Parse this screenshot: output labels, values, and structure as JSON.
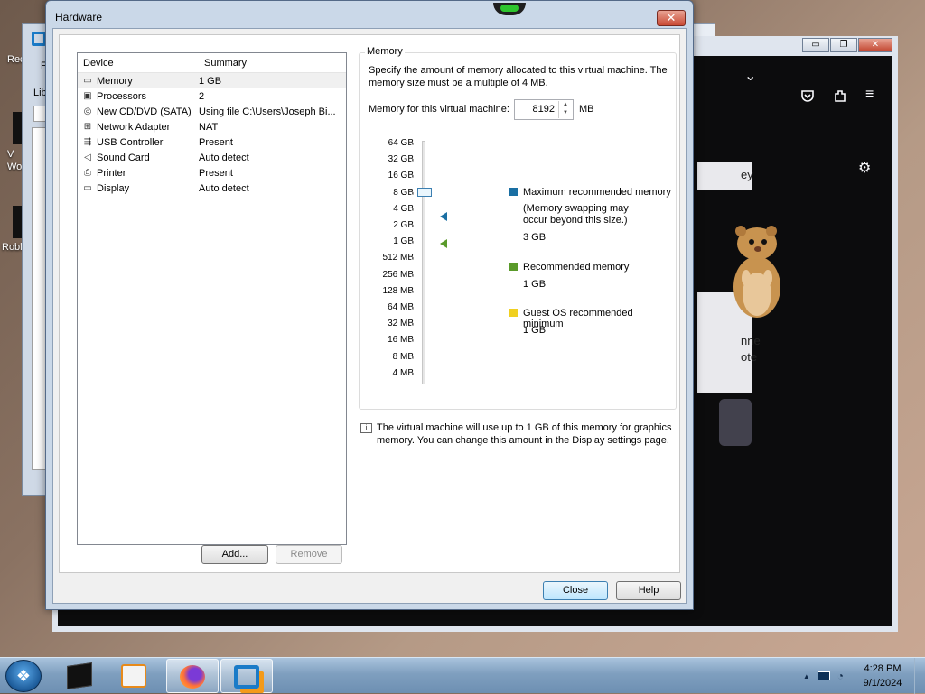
{
  "desktop": {
    "icons": [
      {
        "label": "Rec"
      },
      {
        "label": "V Wo"
      },
      {
        "label": "Robl"
      }
    ]
  },
  "bg_window_left": {
    "frag_1": "F",
    "frag_2": "Lib"
  },
  "firefox": {
    "partial_texts": [
      "ey",
      "nne",
      "ote"
    ],
    "controls": {
      "minimize": "▭",
      "restore": "❐",
      "close": "✕"
    },
    "icons": [
      "chevron-down-icon",
      "pocket-icon",
      "extensions-icon",
      "menu-icon",
      "settings-icon",
      "back-arrow-icon"
    ]
  },
  "dialog": {
    "title": "Hardware",
    "close_glyph": "✕",
    "device_list": {
      "col_device": "Device",
      "col_summary": "Summary",
      "rows": [
        {
          "icon": "memory-icon",
          "device": "Memory",
          "summary": "1 GB"
        },
        {
          "icon": "processor-icon",
          "device": "Processors",
          "summary": "2"
        },
        {
          "icon": "cd-dvd-icon",
          "device": "New CD/DVD (SATA)",
          "summary": "Using file C:\\Users\\Joseph Bi..."
        },
        {
          "icon": "network-adapter-icon",
          "device": "Network Adapter",
          "summary": "NAT"
        },
        {
          "icon": "usb-icon",
          "device": "USB Controller",
          "summary": "Present"
        },
        {
          "icon": "sound-card-icon",
          "device": "Sound Card",
          "summary": "Auto detect"
        },
        {
          "icon": "printer-icon",
          "device": "Printer",
          "summary": "Present"
        },
        {
          "icon": "display-icon",
          "device": "Display",
          "summary": "Auto detect"
        }
      ]
    },
    "add_label": "Add...",
    "remove_label": "Remove",
    "memory": {
      "group_title": "Memory",
      "description": "Specify the amount of memory allocated to this virtual machine. The memory size must be a multiple of 4 MB.",
      "field_label": "Memory for this virtual machine:",
      "field_value": "8192",
      "unit": "MB",
      "scale": [
        "64 GB",
        "32 GB",
        "16 GB",
        "8 GB",
        "4 GB",
        "2 GB",
        "1 GB",
        "512 MB",
        "256 MB",
        "128 MB",
        "64 MB",
        "32 MB",
        "16 MB",
        "8 MB",
        "4 MB"
      ],
      "selected_scale_label": "8 GB",
      "legend": {
        "max_label": "Maximum recommended memory",
        "max_note": "(Memory swapping may occur beyond this size.)",
        "max_value": "3 GB",
        "rec_label": "Recommended memory",
        "rec_value": "1 GB",
        "guest_label": "Guest OS recommended minimum",
        "guest_value": "1 GB"
      },
      "colors": {
        "max": "#1a6fa3",
        "rec": "#5a9a2a",
        "guest": "#f0d020"
      }
    },
    "info_text": "The virtual machine will use up to 1 GB of this memory for graphics memory. You can change this amount in the Display settings page.",
    "close_label": "Close",
    "help_label": "Help"
  },
  "taskbar": {
    "time": "4:28 PM",
    "date": "9/1/2024",
    "tray_arrow": "▲"
  }
}
